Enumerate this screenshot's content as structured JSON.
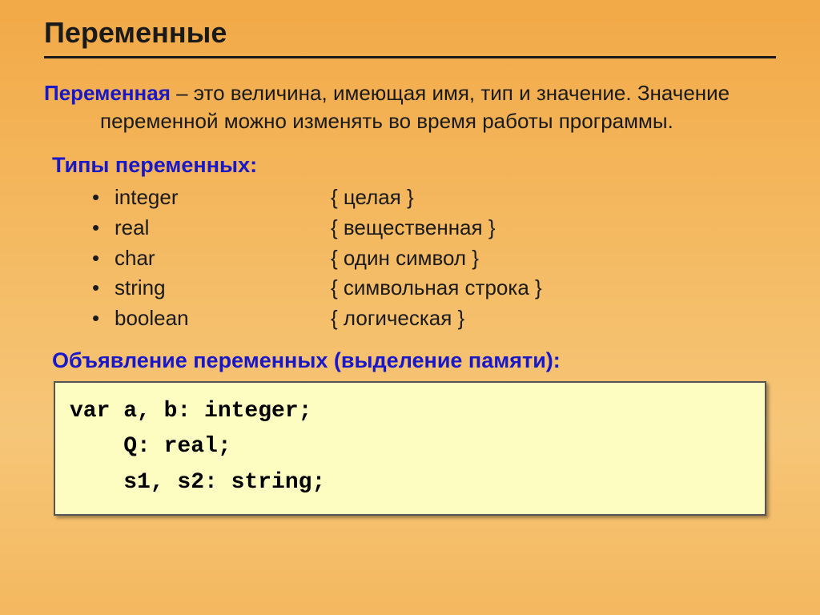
{
  "title": "Переменные",
  "definition": {
    "term": "Переменная",
    "text": " – это величина, имеющая имя, тип и значение. Значение переменной можно изменять во время работы программы."
  },
  "types_heading": "Типы переменных:",
  "types": [
    {
      "name": "integer",
      "desc": "{ целая }"
    },
    {
      "name": "real",
      "desc": "{ вещественная }"
    },
    {
      "name": "char",
      "desc": "{ один символ }"
    },
    {
      "name": "string",
      "desc": "{ символьная строка }"
    },
    {
      "name": "boolean",
      "desc": "{ логическая }"
    }
  ],
  "declaration_heading": "Объявление переменных (выделение памяти):",
  "code": "var a, b: integer;\n    Q: real;\n    s1, s2: string;"
}
